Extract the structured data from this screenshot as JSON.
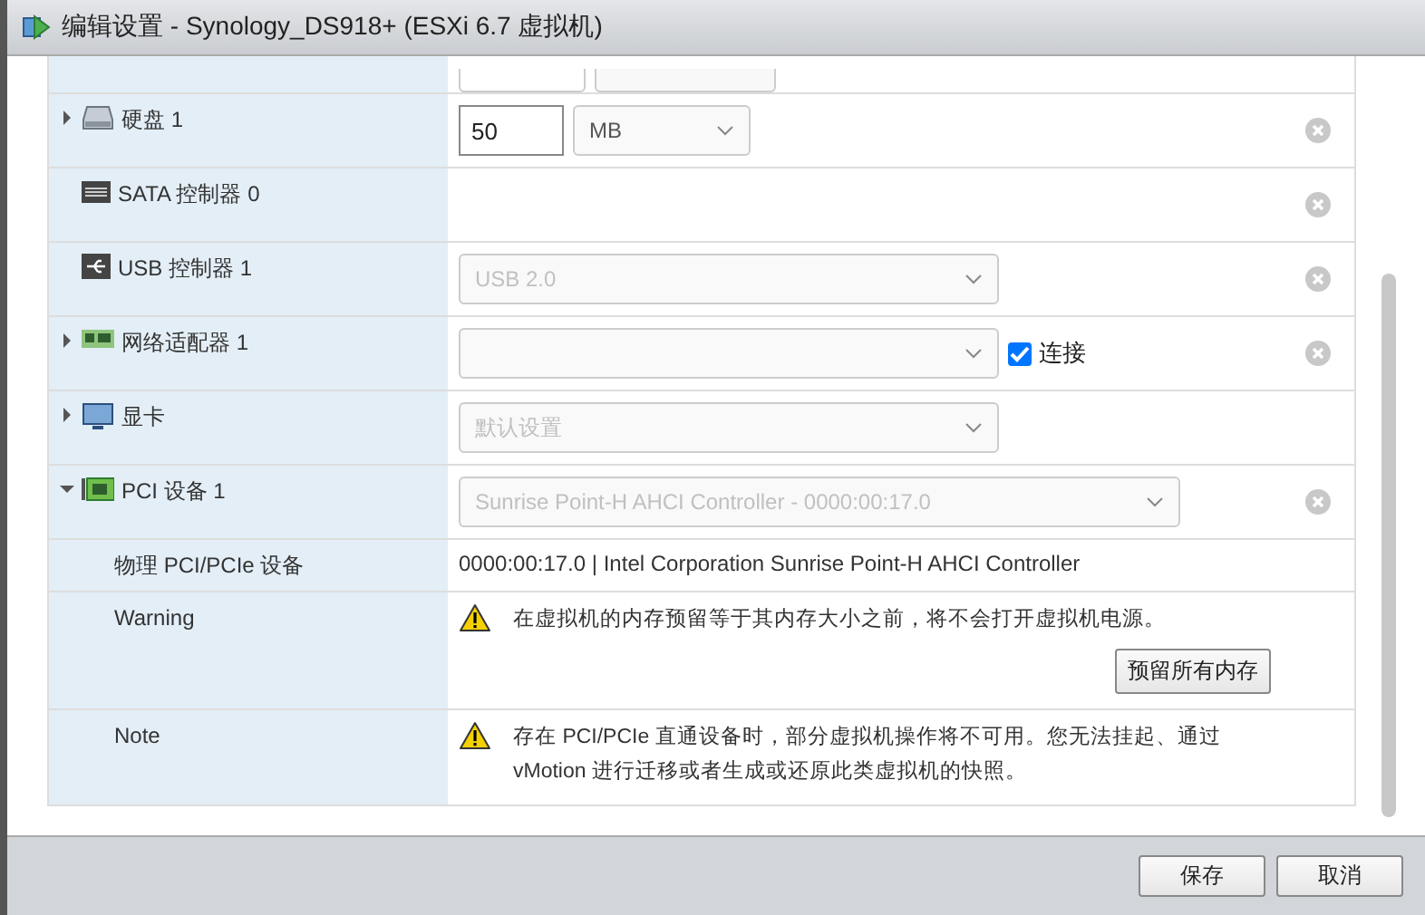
{
  "window": {
    "title": "编辑设置 - Synology_DS918+ (ESXi 6.7 虚拟机)"
  },
  "devices": [
    {
      "label": "硬盘 1",
      "kind": "disk",
      "expanded": false,
      "control": {
        "kind": "size",
        "value": "50",
        "unit": "MB"
      },
      "removable": true
    },
    {
      "label": "SATA 控制器 0",
      "kind": "sata",
      "removable": true
    },
    {
      "label": "USB 控制器 1",
      "kind": "usb",
      "control": {
        "kind": "select",
        "value": "USB 2.0",
        "disabled": true
      },
      "removable": true
    },
    {
      "label": "网络适配器 1",
      "kind": "nic",
      "expanded": false,
      "control": {
        "kind": "select"
      },
      "checkbox": {
        "label": "连接",
        "checked": true
      },
      "removable": true
    },
    {
      "label": "显卡",
      "kind": "monitor",
      "expanded": false,
      "control": {
        "kind": "select",
        "value": "默认设置",
        "disabled": true
      },
      "removable": false
    },
    {
      "label": "PCI 设备 1",
      "kind": "pci",
      "expanded": true,
      "control": {
        "kind": "select",
        "wide": true,
        "value": "Sunrise Point-H AHCI Controller - 0000:00:17.0",
        "disabled": true
      },
      "removable": true,
      "children": [
        {
          "kind": "text",
          "label": "物理 PCI/PCIe 设备",
          "text": "0000:00:17.0 | Intel Corporation Sunrise Point-H AHCI Controller"
        },
        {
          "kind": "warning",
          "label": "Warning",
          "text": "在虚拟机的内存预留等于其内存大小之前，将不会打开虚拟机电源。",
          "button": "预留所有内存"
        },
        {
          "kind": "warning",
          "label": "Note",
          "text": "存在 PCI/PCIe 直通设备时，部分虚拟机操作将不可用。您无法挂起、通过 vMotion 进行迁移或者生成或还原此类虚拟机的快照。"
        }
      ]
    }
  ],
  "buttons": [
    "保存",
    "取消"
  ]
}
